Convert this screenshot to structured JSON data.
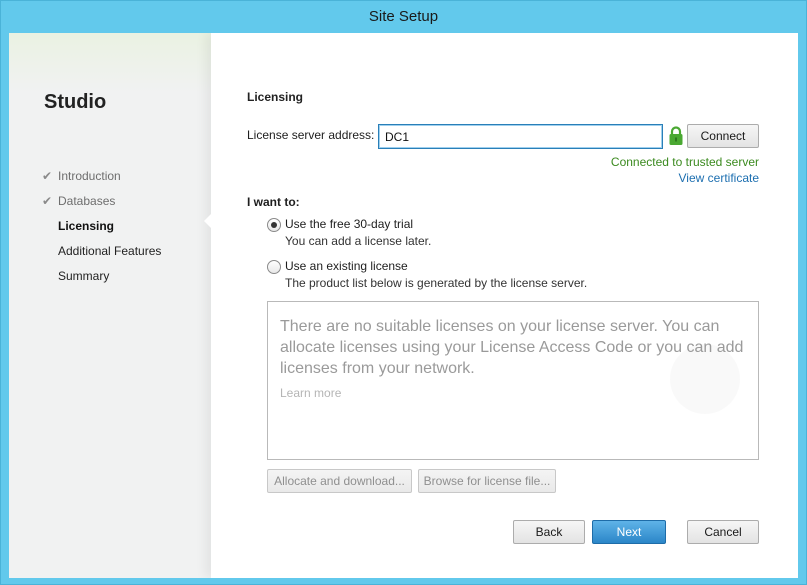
{
  "window": {
    "title": "Site Setup"
  },
  "sidebar": {
    "app_name": "Studio",
    "steps": [
      {
        "label": "Introduction",
        "state": "done"
      },
      {
        "label": "Databases",
        "state": "done"
      },
      {
        "label": "Licensing",
        "state": "current"
      },
      {
        "label": "Additional Features",
        "state": "todo"
      },
      {
        "label": "Summary",
        "state": "todo"
      }
    ]
  },
  "main": {
    "heading": "Licensing",
    "server_label": "License server address:",
    "server_value": "DC1",
    "connect_label": "Connect",
    "status_text": "Connected to trusted server",
    "status_color": "#3b8a1f",
    "view_cert_link": "View certificate",
    "i_want_label": "I want to:",
    "options": [
      {
        "label": "Use the free 30-day trial",
        "sub": "You can add a license later.",
        "selected": true
      },
      {
        "label": "Use an existing license",
        "sub": "The product list below is generated by the license server.",
        "selected": false
      }
    ],
    "license_list": {
      "message": "There are no suitable licenses on your license server. You can allocate licenses using your License Access Code or you can add licenses from your network.",
      "learn_more": "Learn more"
    },
    "allocate_label": "Allocate and download...",
    "browse_label": "Browse for license file..."
  },
  "footer": {
    "back_label": "Back",
    "next_label": "Next",
    "cancel_label": "Cancel"
  },
  "colors": {
    "titlebar": "#62c9ec",
    "accent": "#2b86c8",
    "link": "#1d6fb0",
    "lock": "#4aa832"
  },
  "icons": {
    "lock": "lock-icon",
    "check": "checkmark-icon"
  }
}
